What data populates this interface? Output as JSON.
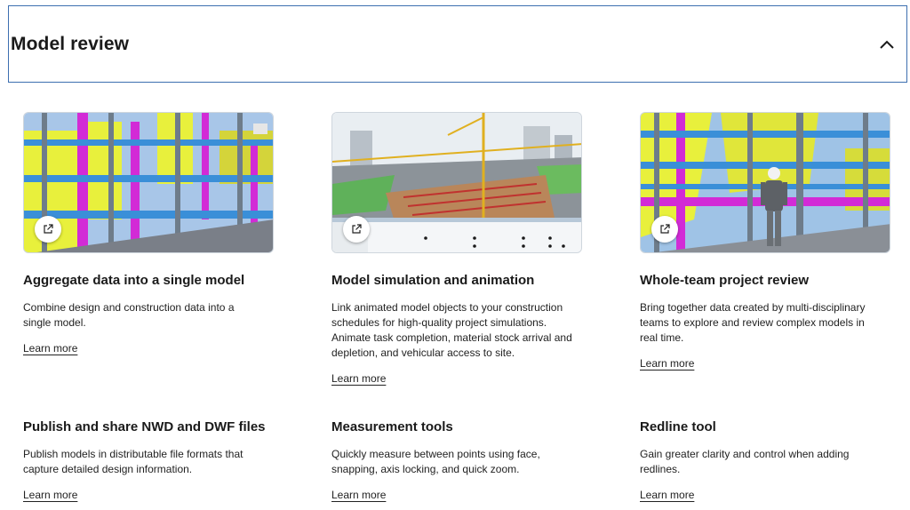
{
  "section": {
    "title": "Model review",
    "toggle_icon": "chevron-up-icon"
  },
  "cards": [
    {
      "title": "Aggregate data into a single model",
      "description": "Combine design and construction data into a single model.",
      "link": "Learn more",
      "thumbnail_icon": "external-link-icon"
    },
    {
      "title": "Model simulation and animation",
      "description": "Link animated model objects to your construction schedules for high-quality project simulations. Animate task completion, material stock arrival and depletion, and vehicular access to site.",
      "link": "Learn more",
      "thumbnail_icon": "external-link-icon"
    },
    {
      "title": "Whole-team project review",
      "description": "Bring together data created by multi-disciplinary teams to explore and review complex models in real time.",
      "link": "Learn more",
      "thumbnail_icon": "external-link-icon"
    },
    {
      "title": "Publish and share NWD and DWF files",
      "description": "Publish models in distributable file formats that capture detailed design information.",
      "link": "Learn more"
    },
    {
      "title": "Measurement tools",
      "description": "Quickly measure between points using face, snapping, axis locking, and quick zoom.",
      "link": "Learn more"
    },
    {
      "title": "Redline tool",
      "description": "Gain greater clarity and control when adding redlines.",
      "link": "Learn more"
    }
  ],
  "colors": {
    "border_accent": "#3d6fb0",
    "text": "#1a1a1a"
  }
}
